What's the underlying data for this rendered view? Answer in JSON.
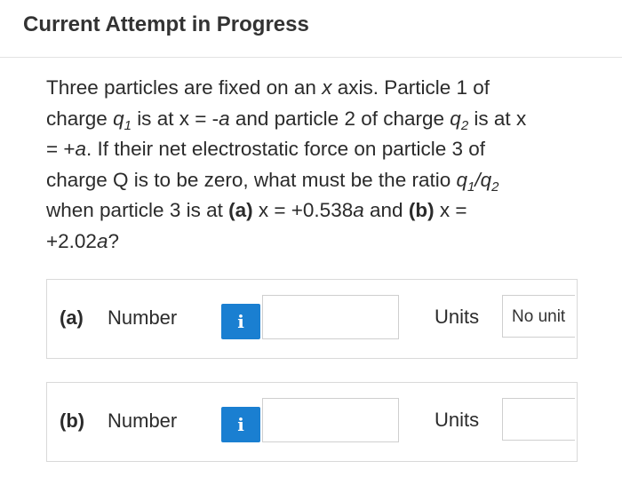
{
  "header": {
    "title": "Current Attempt in Progress"
  },
  "question": {
    "line1": "Three particles are fixed on an",
    "x_var": "x",
    "line1b": "axis. Particle 1 of",
    "charge_word": "charge",
    "q1_base": "q",
    "q1_sub": "1",
    "is_at": "is at x = -",
    "a1": "a",
    "and_p2": "and particle 2 of charge",
    "q2_base": "q",
    "q2_sub": "2",
    "is_at_x": "is at x",
    "eq_plus": "= +",
    "a2": "a",
    "rest1": ". If their net electrostatic force on particle 3 of",
    "rest2": "charge Q is to be zero, what must be the ratio",
    "ratio_q1": "q",
    "ratio_s1": "1",
    "ratio_slash": "/",
    "ratio_q2": "q",
    "ratio_s2": "2",
    "rest3": "when particle 3 is at",
    "part_a_tag": "(a)",
    "part_a_val": "x = +0.538",
    "a3": "a",
    "and_word": "and",
    "part_b_tag": "(b)",
    "part_b_val": "x =",
    "part_b_num": "+2.02",
    "a4": "a",
    "qmark": "?"
  },
  "answers": [
    {
      "part": "(a)",
      "number_label": "Number",
      "info": "i",
      "units_label": "Units",
      "units_value": "No unit"
    },
    {
      "part": "(b)",
      "number_label": "Number",
      "info": "i",
      "units_label": "Units",
      "units_value": ""
    }
  ]
}
